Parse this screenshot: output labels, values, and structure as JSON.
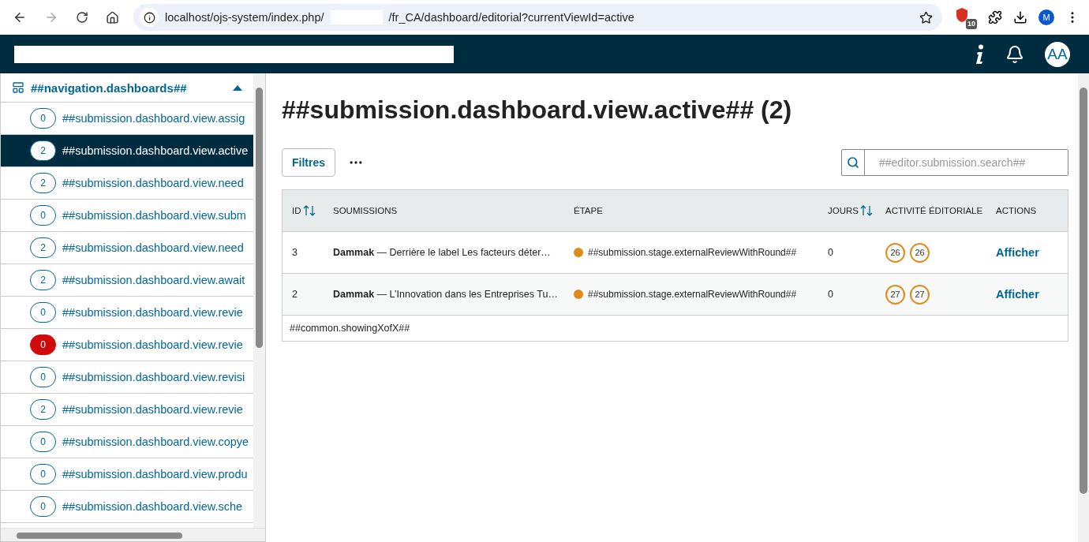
{
  "browser": {
    "url_start": "localhost/ojs-system/index.php/",
    "url_end": "/fr_CA/dashboard/editorial?currentViewId=active",
    "extension_badge": "10",
    "profile_initial": "M"
  },
  "header": {
    "user_initials": "AA"
  },
  "sidebar": {
    "title": "##navigation.dashboards##",
    "expanded": true,
    "items": [
      {
        "count": "0",
        "label": "##submission.dashboard.view.assig",
        "selected": false,
        "alert": false
      },
      {
        "count": "2",
        "label": "##submission.dashboard.view.active",
        "selected": true,
        "alert": false
      },
      {
        "count": "2",
        "label": "##submission.dashboard.view.need",
        "selected": false,
        "alert": false
      },
      {
        "count": "0",
        "label": "##submission.dashboard.view.subm",
        "selected": false,
        "alert": false
      },
      {
        "count": "2",
        "label": "##submission.dashboard.view.need",
        "selected": false,
        "alert": false
      },
      {
        "count": "2",
        "label": "##submission.dashboard.view.await",
        "selected": false,
        "alert": false
      },
      {
        "count": "0",
        "label": "##submission.dashboard.view.revie",
        "selected": false,
        "alert": false
      },
      {
        "count": "0",
        "label": "##submission.dashboard.view.revie",
        "selected": false,
        "alert": true
      },
      {
        "count": "0",
        "label": "##submission.dashboard.view.revisi",
        "selected": false,
        "alert": false
      },
      {
        "count": "2",
        "label": "##submission.dashboard.view.revie",
        "selected": false,
        "alert": false
      },
      {
        "count": "0",
        "label": "##submission.dashboard.view.copye",
        "selected": false,
        "alert": false
      },
      {
        "count": "0",
        "label": "##submission.dashboard.view.produ",
        "selected": false,
        "alert": false
      },
      {
        "count": "0",
        "label": "##submission.dashboard.view.sche",
        "selected": false,
        "alert": false
      }
    ]
  },
  "main": {
    "title": "##submission.dashboard.view.active## (2)",
    "filter_button": "Filtres",
    "search_placeholder": "##editor.submission.search##",
    "columns": [
      {
        "label": "ID",
        "sortable": true
      },
      {
        "label": "SOUMISSIONS",
        "sortable": false
      },
      {
        "label": "ÉTAPE",
        "sortable": false
      },
      {
        "label": "JOURS",
        "sortable": true
      },
      {
        "label": "ACTIVITÉ ÉDITORIALE",
        "sortable": false
      },
      {
        "label": "ACTIONS",
        "sortable": false
      }
    ],
    "rows": [
      {
        "id": "3",
        "submission": "**Dammak** — Derrière le label  Les facteurs déter…",
        "stage": "##submission.stage.externalReviewWithRound##",
        "days": "0",
        "activity": [
          "26",
          "26"
        ],
        "action": "Afficher"
      },
      {
        "id": "2",
        "submission": "**Dammak** — L’Innovation dans les Entreprises Tu…",
        "stage": "##submission.stage.externalReviewWithRound##",
        "days": "0",
        "activity": [
          "27",
          "27"
        ],
        "action": "Afficher"
      }
    ],
    "footer": "##common.showingXofX##"
  }
}
